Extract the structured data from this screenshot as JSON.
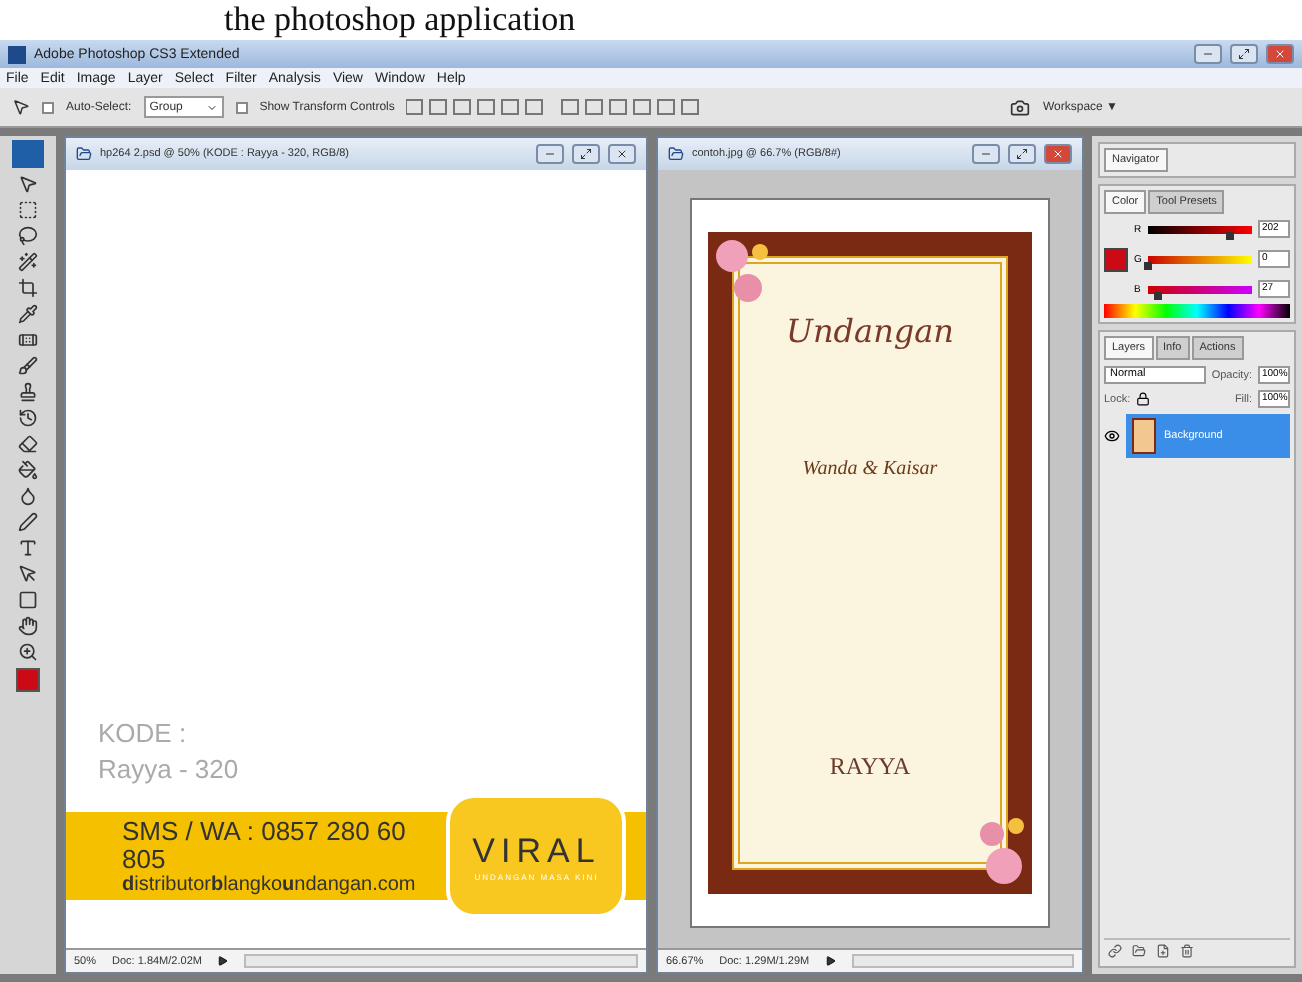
{
  "caption": "the photoshop application",
  "window": {
    "title": "Adobe Photoshop CS3 Extended"
  },
  "menu": [
    "File",
    "Edit",
    "Image",
    "Layer",
    "Select",
    "Filter",
    "Analysis",
    "View",
    "Window",
    "Help"
  ],
  "options_bar": {
    "auto_select": {
      "label": "Auto-Select:",
      "checked": false
    },
    "group_select": "Group",
    "show_transform": {
      "label": "Show Transform Controls",
      "checked": false
    },
    "workspace": "Workspace ▼"
  },
  "documents": [
    {
      "kind": "banner",
      "title": "hp264 2.psd @ 50% (KODE : Rayya - 320, RGB/8)",
      "zoom": "50%",
      "doc_size": "Doc: 1.84M/2.02M",
      "content": {
        "code_label": "KODE :",
        "code_value": "Rayya - 320",
        "phone": "SMS / WA : 0857 280 60 805",
        "site": "**d**istributor**b**langko**u**ndangan.com",
        "brand": "VIRAL",
        "tagline": "UNDANGAN MASA KINI"
      }
    },
    {
      "kind": "invitation",
      "title": "contoh.jpg @ 66.7% (RGB/8#)",
      "zoom": "66.67%",
      "doc_size": "Doc: 1.29M/1.29M",
      "content": {
        "heading": "Undangan",
        "names": "Wanda & Kaisar",
        "brand": "RAYYA"
      }
    }
  ],
  "panels": {
    "navigator": {
      "tabs": [
        {
          "label": "Navigator",
          "selected": true
        }
      ]
    },
    "color": {
      "tabs": [
        {
          "label": "Color",
          "selected": true
        },
        {
          "label": "Tool Presets",
          "selected": false
        }
      ],
      "channels": [
        {
          "label": "R",
          "level": 0.79,
          "reading": "202"
        },
        {
          "label": "G",
          "level": 0.0,
          "reading": "0"
        },
        {
          "label": "B",
          "level": 0.1,
          "reading": "27"
        }
      ]
    },
    "layers": {
      "tabs": [
        {
          "label": "Layers",
          "selected": true
        },
        {
          "label": "Info",
          "selected": false
        },
        {
          "label": "Actions",
          "selected": false
        }
      ],
      "blend_mode": "Normal",
      "opacity_label": "Opacity:",
      "opacity": "100%",
      "lock_label": "Lock:",
      "fill_label": "Fill:",
      "fill": "100%",
      "layers": [
        {
          "name": "Background",
          "selected": true,
          "visible": true
        }
      ]
    }
  }
}
